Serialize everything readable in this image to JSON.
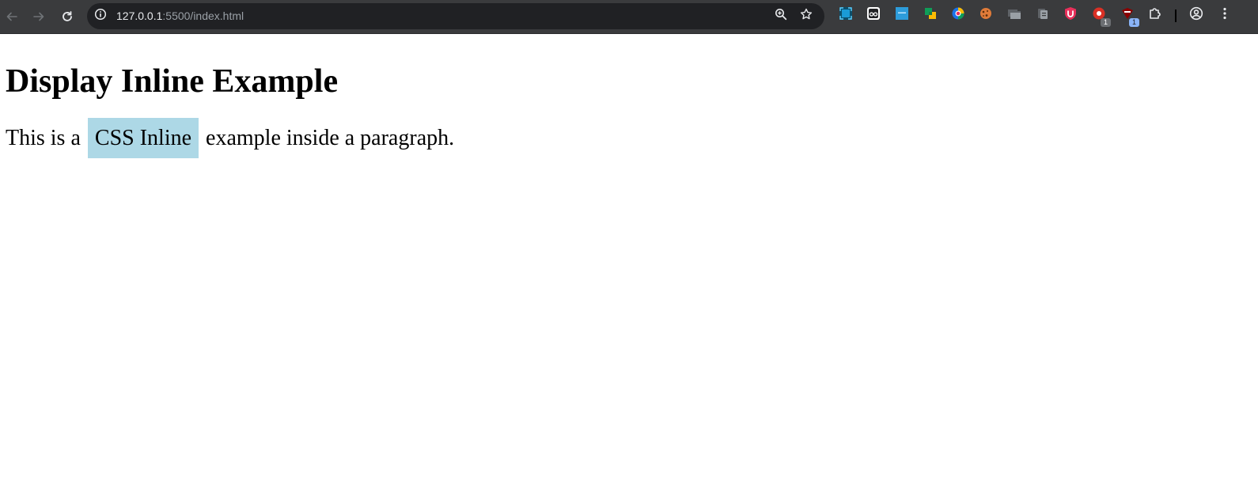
{
  "browser": {
    "url_host": "127.0.0.1",
    "url_path": ":5500/index.html",
    "extensions": [
      {
        "name": "screen-capture-extension-icon",
        "color": "#1a73e8"
      },
      {
        "name": "reader-extension-icon",
        "color": "#ffffff"
      },
      {
        "name": "apps-extension-icon",
        "color": "#2d9cdb"
      },
      {
        "name": "google-keep-extension-icon",
        "color": "#fbbc04"
      },
      {
        "name": "edge-extension-icon",
        "color": "#0f9d58"
      },
      {
        "name": "cookie-extension-icon",
        "color": "#e07b39"
      },
      {
        "name": "tab-groups-extension-icon",
        "color": "#9aa0a6"
      },
      {
        "name": "clipboard-extension-icon",
        "color": "#9aa0a6"
      },
      {
        "name": "ublock-extension-icon",
        "color": "#e8305b"
      },
      {
        "name": "red-extension-icon",
        "color": "#d93025",
        "badge": "1"
      },
      {
        "name": "dark-red-extension-icon",
        "color": "#8b0000",
        "badge": "1"
      }
    ]
  },
  "page": {
    "heading": "Display Inline Example",
    "paragraph_before": "This is a",
    "inline_text": "CSS Inline",
    "paragraph_after": "example inside a paragraph.",
    "inline_bg_color": "#add8e6"
  }
}
